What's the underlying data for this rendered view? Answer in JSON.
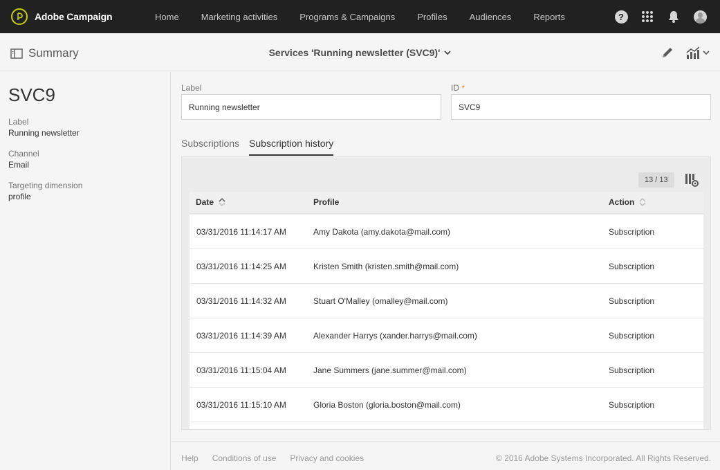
{
  "app": {
    "brand": "Adobe Campaign",
    "nav": [
      "Home",
      "Marketing activities",
      "Programs & Campaigns",
      "Profiles",
      "Audiences",
      "Reports"
    ],
    "icons": [
      "help-icon",
      "app-switcher-icon",
      "bell-icon",
      "avatar-icon"
    ],
    "help_glyph": "?"
  },
  "subheader": {
    "summary_label": "Summary",
    "title": "Services 'Running newsletter (SVC9)'"
  },
  "summary": {
    "id": "SVC9",
    "label_caption": "Label",
    "label_value": "Running newsletter",
    "channel_caption": "Channel",
    "channel_value": "Email",
    "targeting_caption": "Targeting dimension",
    "targeting_value": "profile"
  },
  "form": {
    "label_field": {
      "label": "Label",
      "value": "Running newsletter"
    },
    "id_field": {
      "label": "ID",
      "required_mark": "*",
      "value": "SVC9"
    }
  },
  "tabs": [
    {
      "label": "Subscriptions",
      "active": false
    },
    {
      "label": "Subscription history",
      "active": true
    }
  ],
  "grid": {
    "count": "13 / 13",
    "columns": {
      "date": "Date",
      "profile": "Profile",
      "action": "Action"
    },
    "rows": [
      {
        "date": "03/31/2016 11:14:17 AM",
        "profile": "Amy Dakota (amy.dakota@mail.com)",
        "action": "Subscription"
      },
      {
        "date": "03/31/2016 11:14:25 AM",
        "profile": "Kristen Smith (kristen.smith@mail.com)",
        "action": "Subscription"
      },
      {
        "date": "03/31/2016 11:14:32 AM",
        "profile": "Stuart O'Malley (omalley@mail.com)",
        "action": "Subscription"
      },
      {
        "date": "03/31/2016 11:14:39 AM",
        "profile": "Alexander Harrys (xander.harrys@mail.com)",
        "action": "Subscription"
      },
      {
        "date": "03/31/2016 11:15:04 AM",
        "profile": "Jane Summers (jane.summer@mail.com)",
        "action": "Subscription"
      },
      {
        "date": "03/31/2016 11:15:10 AM",
        "profile": "Gloria Boston (gloria.boston@mail.com)",
        "action": "Subscription"
      },
      {
        "date": "",
        "profile": "",
        "action": ""
      }
    ]
  },
  "footer": {
    "links": [
      "Help",
      "Conditions of use",
      "Privacy and cookies"
    ],
    "copyright": "© 2016 Adobe Systems Incorporated. All Rights Reserved."
  },
  "colors": {
    "topbar": "#212121",
    "logo_accent": "#c8d200",
    "required": "#e68619",
    "background": "#f5f5f5"
  }
}
